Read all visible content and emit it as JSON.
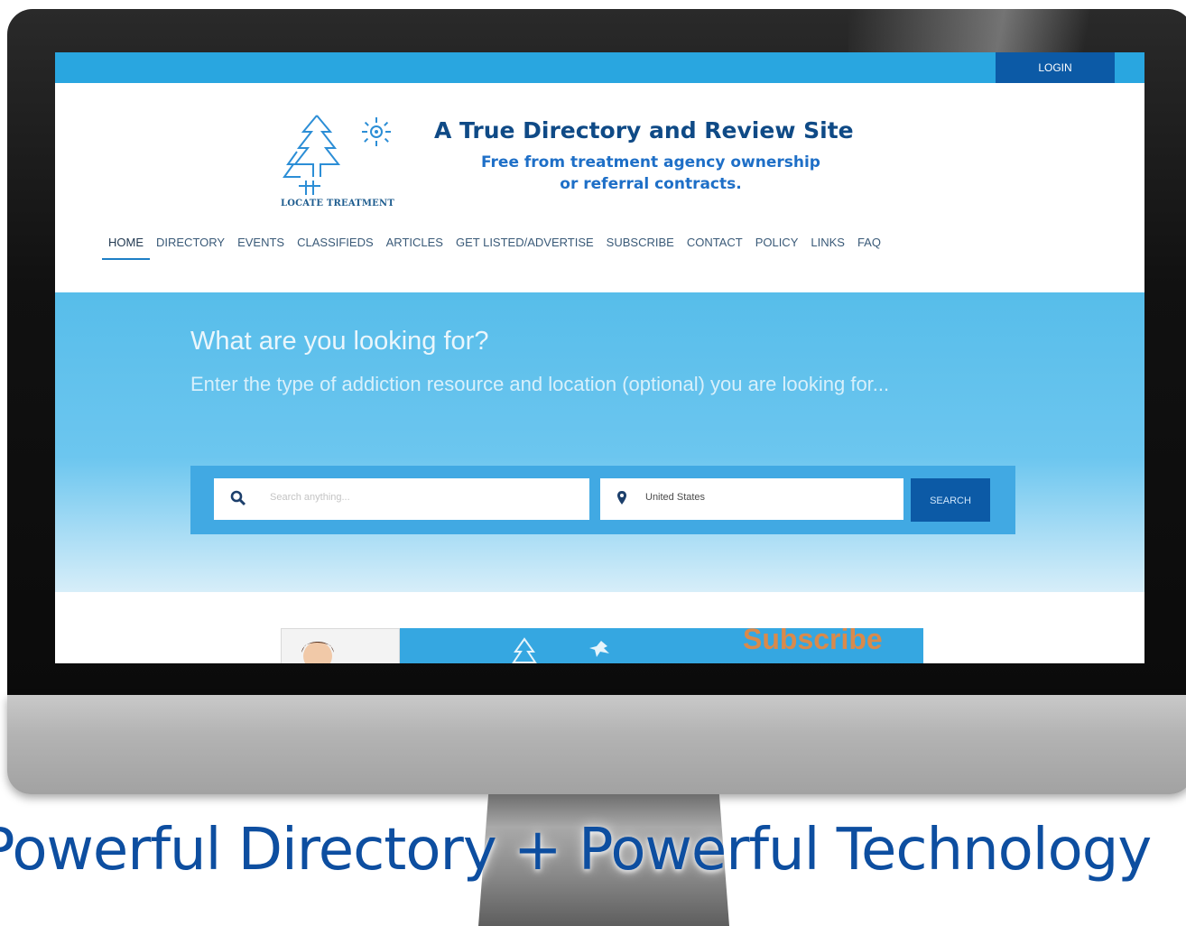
{
  "topbar": {
    "login_label": "LOGIN"
  },
  "logo": {
    "text": "LOCATE TREATMENT"
  },
  "header": {
    "headline": "A True Directory and Review Site",
    "subline1": "Free from treatment agency ownership",
    "subline2": "or referral contracts."
  },
  "nav": {
    "items": [
      "HOME",
      "DIRECTORY",
      "EVENTS",
      "CLASSIFIEDS",
      "ARTICLES",
      "GET LISTED/ADVERTISE",
      "SUBSCRIBE",
      "CONTACT",
      "POLICY",
      "LINKS",
      "FAQ"
    ],
    "active": "HOME"
  },
  "hero": {
    "title": "What are you looking for?",
    "subtitle": "Enter the type of addiction resource and location (optional) you are looking for..."
  },
  "search": {
    "placeholder": "Search anything...",
    "location_value": "United States",
    "button_label": "SEARCH"
  },
  "banner": {
    "label": "Subscribe"
  },
  "tagline": "Powerful Directory + Powerful Technology",
  "colors": {
    "topbar": "#29a6e0",
    "accent_dark": "#0c5aa6",
    "headline": "#0f4a86",
    "tagline": "#0d4ea0"
  },
  "icons": [
    "search-icon",
    "location-pin-icon",
    "tree-icon",
    "sun-icon"
  ]
}
